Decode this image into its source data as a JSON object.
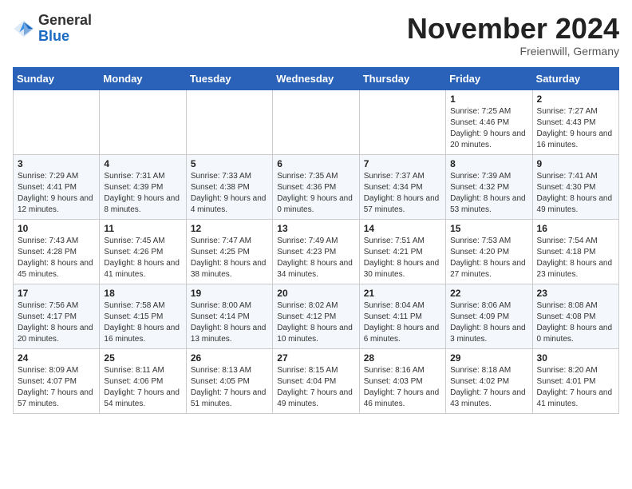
{
  "logo": {
    "general": "General",
    "blue": "Blue"
  },
  "header": {
    "month": "November 2024",
    "location": "Freienwill, Germany"
  },
  "weekdays": [
    "Sunday",
    "Monday",
    "Tuesday",
    "Wednesday",
    "Thursday",
    "Friday",
    "Saturday"
  ],
  "weeks": [
    [
      {
        "day": "",
        "info": ""
      },
      {
        "day": "",
        "info": ""
      },
      {
        "day": "",
        "info": ""
      },
      {
        "day": "",
        "info": ""
      },
      {
        "day": "",
        "info": ""
      },
      {
        "day": "1",
        "info": "Sunrise: 7:25 AM\nSunset: 4:46 PM\nDaylight: 9 hours and 20 minutes."
      },
      {
        "day": "2",
        "info": "Sunrise: 7:27 AM\nSunset: 4:43 PM\nDaylight: 9 hours and 16 minutes."
      }
    ],
    [
      {
        "day": "3",
        "info": "Sunrise: 7:29 AM\nSunset: 4:41 PM\nDaylight: 9 hours and 12 minutes."
      },
      {
        "day": "4",
        "info": "Sunrise: 7:31 AM\nSunset: 4:39 PM\nDaylight: 9 hours and 8 minutes."
      },
      {
        "day": "5",
        "info": "Sunrise: 7:33 AM\nSunset: 4:38 PM\nDaylight: 9 hours and 4 minutes."
      },
      {
        "day": "6",
        "info": "Sunrise: 7:35 AM\nSunset: 4:36 PM\nDaylight: 9 hours and 0 minutes."
      },
      {
        "day": "7",
        "info": "Sunrise: 7:37 AM\nSunset: 4:34 PM\nDaylight: 8 hours and 57 minutes."
      },
      {
        "day": "8",
        "info": "Sunrise: 7:39 AM\nSunset: 4:32 PM\nDaylight: 8 hours and 53 minutes."
      },
      {
        "day": "9",
        "info": "Sunrise: 7:41 AM\nSunset: 4:30 PM\nDaylight: 8 hours and 49 minutes."
      }
    ],
    [
      {
        "day": "10",
        "info": "Sunrise: 7:43 AM\nSunset: 4:28 PM\nDaylight: 8 hours and 45 minutes."
      },
      {
        "day": "11",
        "info": "Sunrise: 7:45 AM\nSunset: 4:26 PM\nDaylight: 8 hours and 41 minutes."
      },
      {
        "day": "12",
        "info": "Sunrise: 7:47 AM\nSunset: 4:25 PM\nDaylight: 8 hours and 38 minutes."
      },
      {
        "day": "13",
        "info": "Sunrise: 7:49 AM\nSunset: 4:23 PM\nDaylight: 8 hours and 34 minutes."
      },
      {
        "day": "14",
        "info": "Sunrise: 7:51 AM\nSunset: 4:21 PM\nDaylight: 8 hours and 30 minutes."
      },
      {
        "day": "15",
        "info": "Sunrise: 7:53 AM\nSunset: 4:20 PM\nDaylight: 8 hours and 27 minutes."
      },
      {
        "day": "16",
        "info": "Sunrise: 7:54 AM\nSunset: 4:18 PM\nDaylight: 8 hours and 23 minutes."
      }
    ],
    [
      {
        "day": "17",
        "info": "Sunrise: 7:56 AM\nSunset: 4:17 PM\nDaylight: 8 hours and 20 minutes."
      },
      {
        "day": "18",
        "info": "Sunrise: 7:58 AM\nSunset: 4:15 PM\nDaylight: 8 hours and 16 minutes."
      },
      {
        "day": "19",
        "info": "Sunrise: 8:00 AM\nSunset: 4:14 PM\nDaylight: 8 hours and 13 minutes."
      },
      {
        "day": "20",
        "info": "Sunrise: 8:02 AM\nSunset: 4:12 PM\nDaylight: 8 hours and 10 minutes."
      },
      {
        "day": "21",
        "info": "Sunrise: 8:04 AM\nSunset: 4:11 PM\nDaylight: 8 hours and 6 minutes."
      },
      {
        "day": "22",
        "info": "Sunrise: 8:06 AM\nSunset: 4:09 PM\nDaylight: 8 hours and 3 minutes."
      },
      {
        "day": "23",
        "info": "Sunrise: 8:08 AM\nSunset: 4:08 PM\nDaylight: 8 hours and 0 minutes."
      }
    ],
    [
      {
        "day": "24",
        "info": "Sunrise: 8:09 AM\nSunset: 4:07 PM\nDaylight: 7 hours and 57 minutes."
      },
      {
        "day": "25",
        "info": "Sunrise: 8:11 AM\nSunset: 4:06 PM\nDaylight: 7 hours and 54 minutes."
      },
      {
        "day": "26",
        "info": "Sunrise: 8:13 AM\nSunset: 4:05 PM\nDaylight: 7 hours and 51 minutes."
      },
      {
        "day": "27",
        "info": "Sunrise: 8:15 AM\nSunset: 4:04 PM\nDaylight: 7 hours and 49 minutes."
      },
      {
        "day": "28",
        "info": "Sunrise: 8:16 AM\nSunset: 4:03 PM\nDaylight: 7 hours and 46 minutes."
      },
      {
        "day": "29",
        "info": "Sunrise: 8:18 AM\nSunset: 4:02 PM\nDaylight: 7 hours and 43 minutes."
      },
      {
        "day": "30",
        "info": "Sunrise: 8:20 AM\nSunset: 4:01 PM\nDaylight: 7 hours and 41 minutes."
      }
    ]
  ]
}
